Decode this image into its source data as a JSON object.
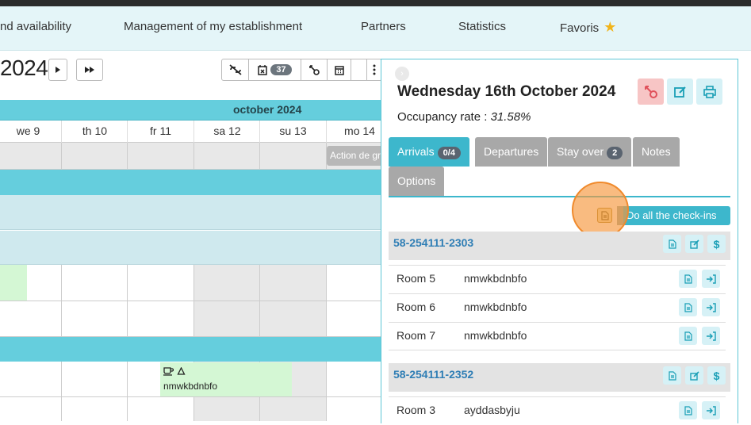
{
  "nav": {
    "items": [
      {
        "label": "nd availability"
      },
      {
        "label": "Management of my establishment"
      },
      {
        "label": "Partners"
      },
      {
        "label": "Statistics"
      },
      {
        "label": "Favoris"
      }
    ]
  },
  "calendar": {
    "year": "2024",
    "event_count": "37",
    "month_label": "october 2024",
    "days": [
      "we 9",
      "th 10",
      "fr 11",
      "sa 12",
      "su 13",
      "mo 14"
    ],
    "action_label": "Action de gr",
    "booking_guest": "nmwkbdnbfo"
  },
  "panel": {
    "title": "Wednesday 16th October 2024",
    "occupancy_label": "Occupancy rate : ",
    "occupancy_value": "31.58%",
    "tabs": [
      {
        "label": "Arrivals",
        "badge": "0/4"
      },
      {
        "label": "Departures"
      },
      {
        "label": "Stay over",
        "badge": "2"
      },
      {
        "label": "Notes"
      },
      {
        "label": "Options"
      }
    ],
    "do_all_label": "Do all the check-ins",
    "groups": [
      {
        "id": "58-254111-2303",
        "rooms": [
          {
            "room": "Room 5",
            "guest": "nmwkbdnbfo"
          },
          {
            "room": "Room 6",
            "guest": "nmwkbdnbfo"
          },
          {
            "room": "Room 7",
            "guest": "nmwkbdnbfo"
          }
        ]
      },
      {
        "id": "58-254111-2352",
        "rooms": [
          {
            "room": "Room 3",
            "guest": "ayddasbyju"
          }
        ]
      }
    ]
  },
  "colors": {
    "accent": "#3db7cc",
    "calendar_header": "#65cedd",
    "booking": "#d4f7d4",
    "link": "#2f7eb5",
    "cursor": "#f08a2c",
    "danger": "#f7c5c5"
  }
}
